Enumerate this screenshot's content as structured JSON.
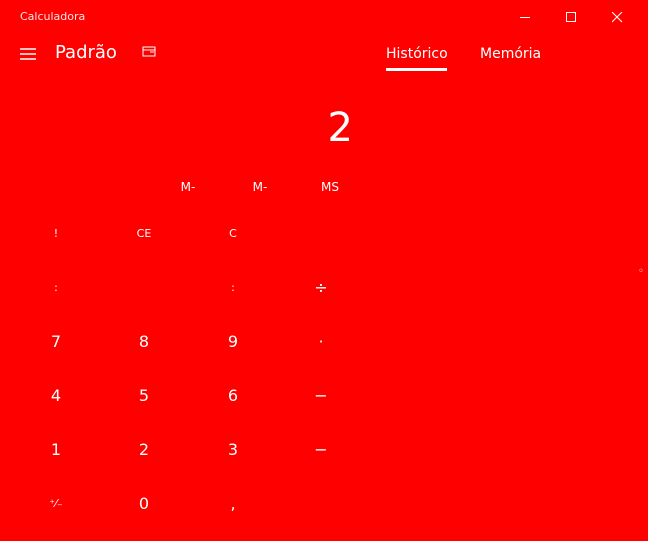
{
  "window": {
    "title": "Calculadora"
  },
  "header": {
    "mode": "Padrão",
    "tabs": [
      {
        "label": "Histórico",
        "active": true
      },
      {
        "label": "Memória",
        "active": false
      }
    ]
  },
  "display": {
    "value": "2"
  },
  "memory_keys": [
    "M-",
    "M-",
    "MS"
  ],
  "keypad": {
    "row1": [
      "!",
      "CE",
      "C",
      ""
    ],
    "row2": [
      ":",
      "",
      ":",
      "÷"
    ],
    "row3": [
      "7",
      "8",
      "9",
      "·"
    ],
    "row4": [
      "4",
      "5",
      "6",
      "−"
    ],
    "row5": [
      "1",
      "2",
      "3",
      "−"
    ],
    "row6": [
      "⁺⁄₋",
      "0",
      ",",
      ""
    ]
  },
  "colors": {
    "background": "#ff0000",
    "foreground": "#ffffff"
  },
  "icons": {
    "minimize": "minimize-icon",
    "maximize": "maximize-icon",
    "close": "close-icon",
    "menu": "hamburger-icon",
    "keep_on_top": "keep-on-top-icon"
  }
}
